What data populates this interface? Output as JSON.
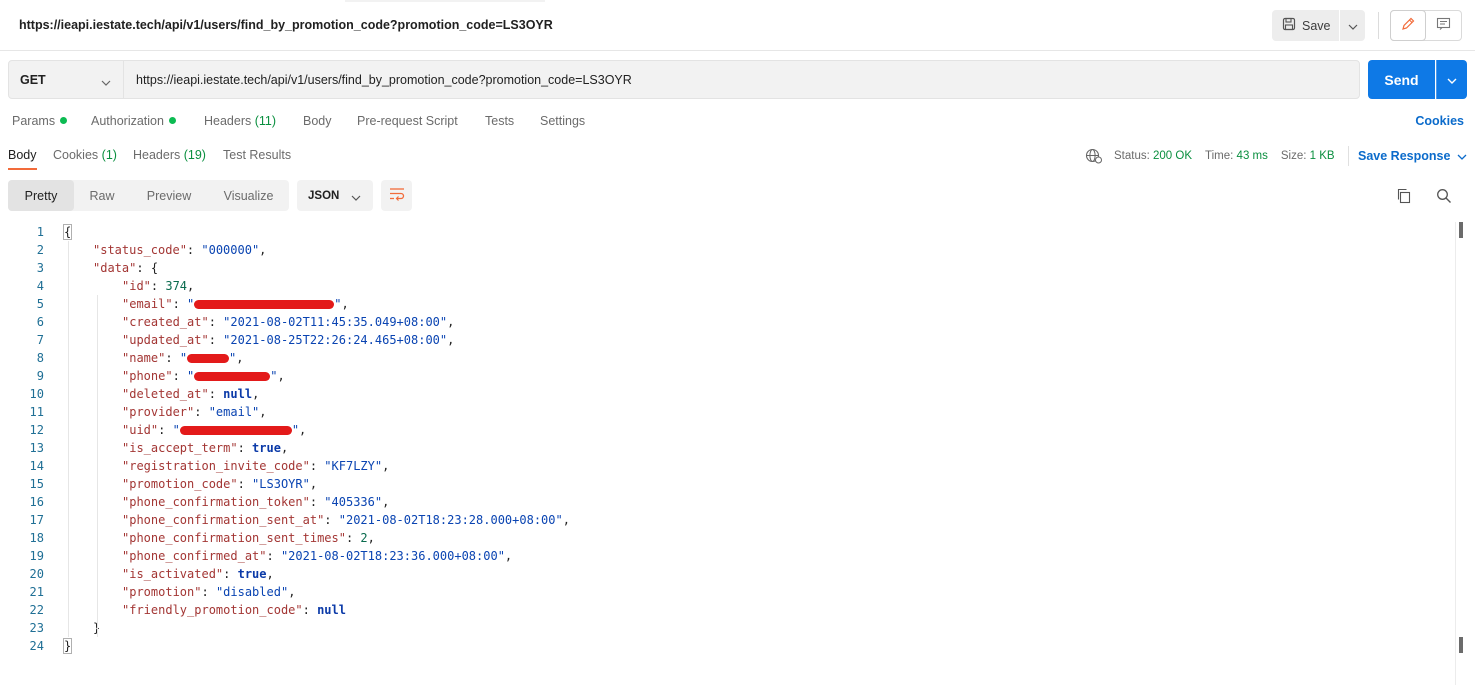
{
  "header": {
    "request_title": "https://ieapi.iestate.tech/api/v1/users/find_by_promotion_code?promotion_code=LS3OYR",
    "save_label": "Save"
  },
  "request": {
    "method": "GET",
    "url": "https://ieapi.iestate.tech/api/v1/users/find_by_promotion_code?promotion_code=LS3OYR",
    "send_label": "Send"
  },
  "request_tabs": {
    "params": "Params",
    "authorization": "Authorization",
    "headers": "Headers",
    "headers_count": "(11)",
    "body": "Body",
    "pre_request": "Pre-request Script",
    "tests": "Tests",
    "settings": "Settings",
    "cookies": "Cookies"
  },
  "response_tabs": {
    "body": "Body",
    "cookies": "Cookies",
    "cookies_count": "(1)",
    "headers": "Headers",
    "headers_count": "(19)",
    "test_results": "Test Results"
  },
  "status": {
    "status_label": "Status:",
    "status_value": "200 OK",
    "time_label": "Time:",
    "time_value": "43 ms",
    "size_label": "Size:",
    "size_value": "1 KB",
    "save_response": "Save Response"
  },
  "view": {
    "pretty": "Pretty",
    "raw": "Raw",
    "preview": "Preview",
    "visualize": "Visualize",
    "format": "JSON"
  },
  "code_lines": [
    {
      "n": "1",
      "indent": 0,
      "pre": "",
      "key": "",
      "sep": "",
      "val": "",
      "vtype": "",
      "post": "{",
      "redact": false
    },
    {
      "n": "2",
      "indent": 1,
      "pre": "",
      "key": "\"status_code\"",
      "sep": ": ",
      "val": "\"000000\"",
      "vtype": "s",
      "post": ",",
      "redact": false
    },
    {
      "n": "3",
      "indent": 1,
      "pre": "",
      "key": "\"data\"",
      "sep": ": ",
      "val": "",
      "vtype": "",
      "post": "{",
      "redact": false
    },
    {
      "n": "4",
      "indent": 2,
      "pre": "",
      "key": "\"id\"",
      "sep": ": ",
      "val": "374",
      "vtype": "n",
      "post": ",",
      "redact": false
    },
    {
      "n": "5",
      "indent": 2,
      "pre": "",
      "key": "\"email\"",
      "sep": ": ",
      "val": "\"",
      "vtype": "s",
      "post": "\",",
      "redact": true,
      "rw": 140
    },
    {
      "n": "6",
      "indent": 2,
      "pre": "",
      "key": "\"created_at\"",
      "sep": ": ",
      "val": "\"2021-08-02T11:45:35.049+08:00\"",
      "vtype": "s",
      "post": ",",
      "redact": false
    },
    {
      "n": "7",
      "indent": 2,
      "pre": "",
      "key": "\"updated_at\"",
      "sep": ": ",
      "val": "\"2021-08-25T22:26:24.465+08:00\"",
      "vtype": "s",
      "post": ",",
      "redact": false
    },
    {
      "n": "8",
      "indent": 2,
      "pre": "",
      "key": "\"name\"",
      "sep": ": ",
      "val": "\"",
      "vtype": "s",
      "post": "\",",
      "redact": true,
      "rw": 42
    },
    {
      "n": "9",
      "indent": 2,
      "pre": "",
      "key": "\"phone\"",
      "sep": ": ",
      "val": "\"",
      "vtype": "s",
      "post": "\",",
      "redact": true,
      "rw": 76
    },
    {
      "n": "10",
      "indent": 2,
      "pre": "",
      "key": "\"deleted_at\"",
      "sep": ": ",
      "val": "null",
      "vtype": "kw",
      "post": ",",
      "redact": false
    },
    {
      "n": "11",
      "indent": 2,
      "pre": "",
      "key": "\"provider\"",
      "sep": ": ",
      "val": "\"email\"",
      "vtype": "s",
      "post": ",",
      "redact": false
    },
    {
      "n": "12",
      "indent": 2,
      "pre": "",
      "key": "\"uid\"",
      "sep": ": ",
      "val": "\"",
      "vtype": "s",
      "post": "\",",
      "redact": true,
      "rw": 112
    },
    {
      "n": "13",
      "indent": 2,
      "pre": "",
      "key": "\"is_accept_term\"",
      "sep": ": ",
      "val": "true",
      "vtype": "kw",
      "post": ",",
      "redact": false
    },
    {
      "n": "14",
      "indent": 2,
      "pre": "",
      "key": "\"registration_invite_code\"",
      "sep": ": ",
      "val": "\"KF7LZY\"",
      "vtype": "s",
      "post": ",",
      "redact": false
    },
    {
      "n": "15",
      "indent": 2,
      "pre": "",
      "key": "\"promotion_code\"",
      "sep": ": ",
      "val": "\"LS3OYR\"",
      "vtype": "s",
      "post": ",",
      "redact": false
    },
    {
      "n": "16",
      "indent": 2,
      "pre": "",
      "key": "\"phone_confirmation_token\"",
      "sep": ": ",
      "val": "\"405336\"",
      "vtype": "s",
      "post": ",",
      "redact": false
    },
    {
      "n": "17",
      "indent": 2,
      "pre": "",
      "key": "\"phone_confirmation_sent_at\"",
      "sep": ": ",
      "val": "\"2021-08-02T18:23:28.000+08:00\"",
      "vtype": "s",
      "post": ",",
      "redact": false
    },
    {
      "n": "18",
      "indent": 2,
      "pre": "",
      "key": "\"phone_confirmation_sent_times\"",
      "sep": ": ",
      "val": "2",
      "vtype": "n",
      "post": ",",
      "redact": false
    },
    {
      "n": "19",
      "indent": 2,
      "pre": "",
      "key": "\"phone_confirmed_at\"",
      "sep": ": ",
      "val": "\"2021-08-02T18:23:36.000+08:00\"",
      "vtype": "s",
      "post": ",",
      "redact": false
    },
    {
      "n": "20",
      "indent": 2,
      "pre": "",
      "key": "\"is_activated\"",
      "sep": ": ",
      "val": "true",
      "vtype": "kw",
      "post": ",",
      "redact": false
    },
    {
      "n": "21",
      "indent": 2,
      "pre": "",
      "key": "\"promotion\"",
      "sep": ": ",
      "val": "\"disabled\"",
      "vtype": "s",
      "post": ",",
      "redact": false
    },
    {
      "n": "22",
      "indent": 2,
      "pre": "",
      "key": "\"friendly_promotion_code\"",
      "sep": ": ",
      "val": "null",
      "vtype": "kw",
      "post": "",
      "redact": false
    },
    {
      "n": "23",
      "indent": 1,
      "pre": "",
      "key": "",
      "sep": "",
      "val": "",
      "vtype": "",
      "post": "}",
      "redact": false
    },
    {
      "n": "24",
      "indent": 0,
      "pre": "",
      "key": "",
      "sep": "",
      "val": "",
      "vtype": "",
      "post": "}",
      "redact": false
    }
  ],
  "colors": {
    "accent_blue": "#0e79e6",
    "link_blue": "#0b6bcb",
    "success_green": "#0a8f3f",
    "dot_green": "#0cbb52",
    "tab_underline": "#f26b3a",
    "json_key": "#a33634",
    "json_string": "#0a44b2",
    "redaction": "#e31a1a"
  },
  "icons": {
    "save": "floppy-disk-icon",
    "edit": "pencil-icon",
    "comments": "comment-icon",
    "globe": "globe-icon",
    "wrap": "wrap-lines-icon",
    "copy": "copy-icon",
    "search": "search-icon"
  }
}
